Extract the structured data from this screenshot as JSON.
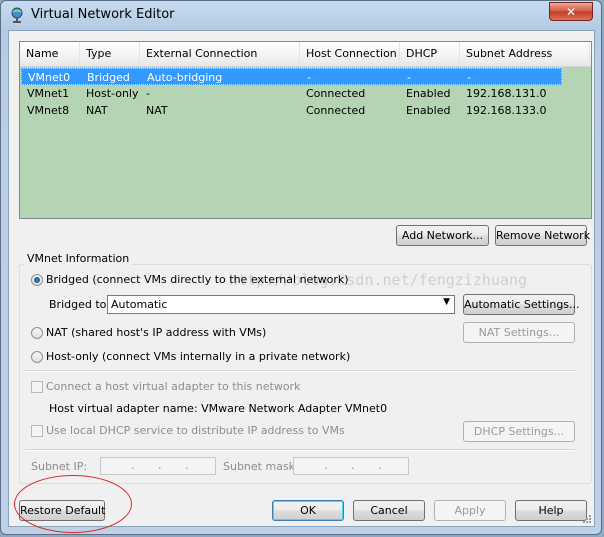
{
  "window": {
    "title": "Virtual Network Editor",
    "close_glyph": "✕"
  },
  "table": {
    "headers": [
      "Name",
      "Type",
      "External Connection",
      "Host Connection",
      "DHCP",
      "Subnet Address"
    ],
    "rows": [
      [
        "VMnet0",
        "Bridged",
        "Auto-bridging",
        "-",
        "-",
        "-"
      ],
      [
        "VMnet1",
        "Host-only",
        "-",
        "Connected",
        "Enabled",
        "192.168.131.0"
      ],
      [
        "VMnet8",
        "NAT",
        "NAT",
        "Connected",
        "Enabled",
        "192.168.133.0"
      ]
    ],
    "selected_row": 0
  },
  "buttons": {
    "add_network": "Add Network...",
    "remove_network": "Remove Network",
    "automatic_settings": "Automatic Settings...",
    "nat_settings": "NAT Settings...",
    "dhcp_settings": "DHCP Settings...",
    "restore_default": "Restore Default",
    "ok": "OK",
    "cancel": "Cancel",
    "apply": "Apply",
    "help": "Help"
  },
  "vmnet_info": {
    "title": "VMnet Information",
    "bridged_label": "Bridged (connect VMs directly to the external network)",
    "bridged_to_label": "Bridged to:",
    "bridged_to_value": "Automatic",
    "nat_label": "NAT (shared host's IP address with VMs)",
    "hostonly_label": "Host-only (connect VMs internally in a private network)",
    "connect_adapter_label": "Connect a host virtual adapter to this network",
    "adapter_name_label": "Host virtual adapter name: VMware Network Adapter VMnet0",
    "dhcp_label": "Use local DHCP service to distribute IP address to VMs",
    "subnet_ip_label": "Subnet IP:",
    "subnet_mask_label": "Subnet mask:",
    "ip_dots": ".",
    "selected_mode": "bridged"
  },
  "watermark": "http://blog.csdn.net/fengzizhuang"
}
